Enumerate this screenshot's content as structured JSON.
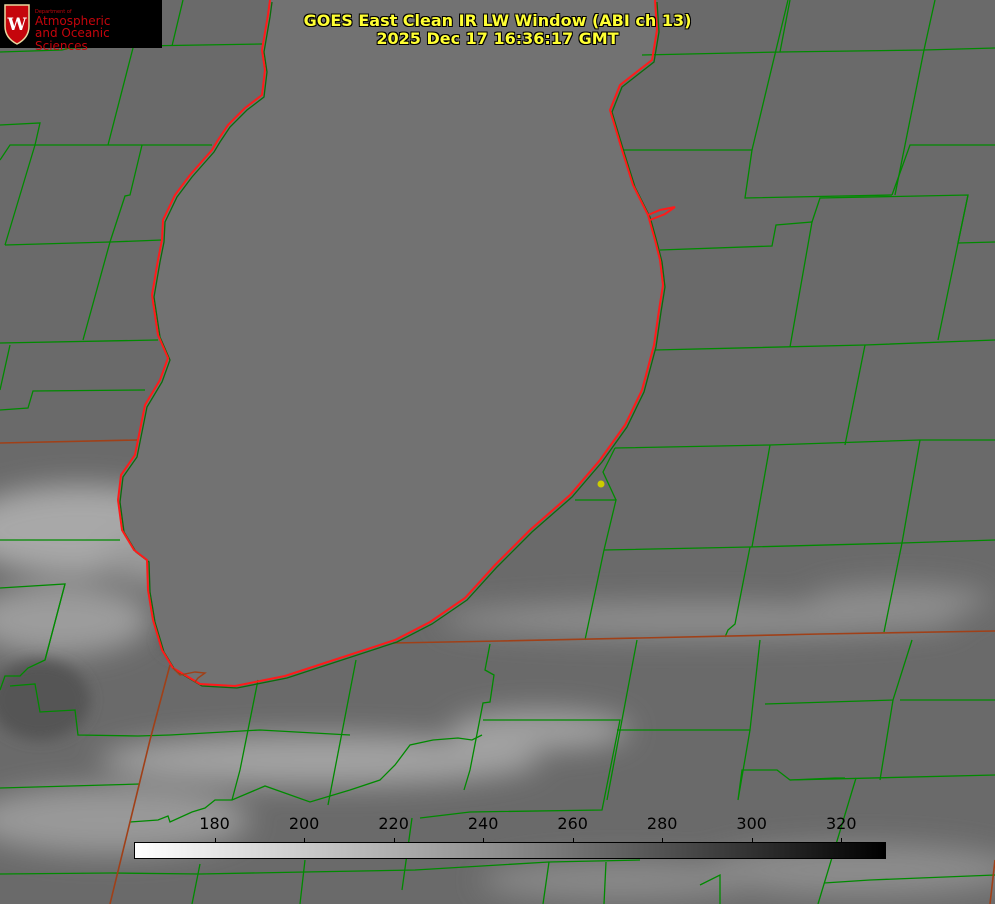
{
  "title": {
    "line1": "GOES East Clean IR LW Window (ABI ch 13)",
    "line2": "2025 Dec 17 16:36:17 GMT"
  },
  "logo": {
    "crest_letter": "W",
    "dept_text": "Department of",
    "line1": "Atmospheric",
    "line2": "and Oceanic Sciences",
    "color": "#c5050c"
  },
  "colorbar": {
    "min": 162,
    "max": 330,
    "ticks": [
      {
        "label": "180",
        "value": 180
      },
      {
        "label": "200",
        "value": 200
      },
      {
        "label": "220",
        "value": 220
      },
      {
        "label": "240",
        "value": 240
      },
      {
        "label": "260",
        "value": 260
      },
      {
        "label": "280",
        "value": 280
      },
      {
        "label": "300",
        "value": 300
      },
      {
        "label": "320",
        "value": 320
      }
    ],
    "gradient_from": "#ffffff",
    "gradient_to": "#000000"
  },
  "colors": {
    "lake": "#6e6e6e",
    "land": "#686868",
    "county_lines": "#008a00",
    "state_lines": "#a04018",
    "coastline": "#ff1a1a",
    "title": "#ffff33",
    "marker": "#cccc00"
  }
}
